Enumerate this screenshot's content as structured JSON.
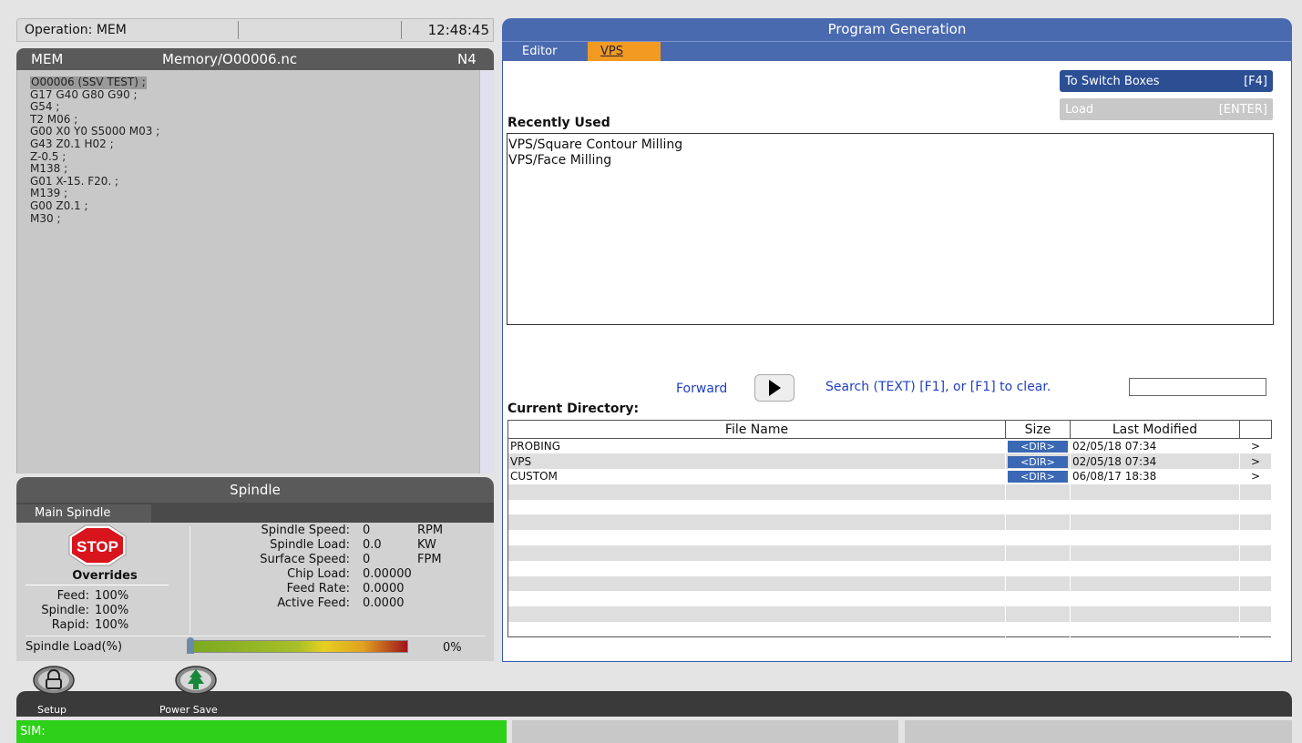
{
  "status_bar": {
    "operation": "Operation: MEM",
    "time": "12:48:45"
  },
  "program": {
    "mode": "MEM",
    "path": "Memory/O00006.nc",
    "line": "N4",
    "code": [
      "O00006 (SSV TEST) ;",
      "G17 G40 G80 G90 ;",
      "G54 ;",
      "T2 M06 ;",
      "G00 X0 Y0 S5000 M03 ;",
      "G43 Z0.1 H02 ;",
      "Z-0.5 ;",
      "M138 ;",
      "G01 X-15. F20. ;",
      "M139 ;",
      "G00 Z0.1 ;",
      "M30 ;"
    ]
  },
  "spindle": {
    "title": "Spindle",
    "tab": "Main Spindle",
    "stop_label": "STOP",
    "overrides_title": "Overrides",
    "overrides": [
      {
        "label": "Feed:",
        "value": "100%"
      },
      {
        "label": "Spindle:",
        "value": "100%"
      },
      {
        "label": "Rapid:",
        "value": "100%"
      }
    ],
    "stats": [
      {
        "label": "Spindle Speed:",
        "value": "0",
        "unit": "RPM"
      },
      {
        "label": "Spindle Load:",
        "value": "0.0",
        "unit": "KW"
      },
      {
        "label": "Surface Speed:",
        "value": "0",
        "unit": "FPM"
      },
      {
        "label": "Chip Load:",
        "value": "0.00000",
        "unit": ""
      },
      {
        "label": "Feed Rate:",
        "value": "0.0000",
        "unit": ""
      },
      {
        "label": "Active Feed:",
        "value": "0.0000",
        "unit": ""
      }
    ],
    "load_label": "Spindle Load(%)",
    "load_value": "0%"
  },
  "program_generation": {
    "title": "Program Generation",
    "tabs": {
      "editor": "Editor",
      "vps": "VPS"
    },
    "switch_button": {
      "label": "To Switch Boxes",
      "key": "[F4]"
    },
    "load_button": {
      "label": "Load",
      "key": "[ENTER]"
    },
    "recently_used_title": "Recently Used",
    "recently_used": [
      "VPS/Square Contour Milling",
      "VPS/Face Milling"
    ],
    "forward_label": "Forward",
    "search_label": "Search (TEXT) [F1], or [F1] to clear.",
    "search_value": "",
    "current_dir_title": "Current Directory:",
    "columns": {
      "name": "File Name",
      "size": "Size",
      "modified": "Last Modified"
    },
    "files": [
      {
        "name": "PROBING",
        "size": "<DIR>",
        "modified": "02/05/18 07:34",
        "arrow": ">"
      },
      {
        "name": "VPS",
        "size": "<DIR>",
        "modified": "02/05/18 07:34",
        "arrow": ">"
      },
      {
        "name": "CUSTOM",
        "size": "<DIR>",
        "modified": "06/08/17 18:38",
        "arrow": ">"
      }
    ]
  },
  "bottom": {
    "setup_label": "Setup",
    "power_save_label": "Power Save",
    "sim_status": "SIM:"
  },
  "colors": {
    "accent_blue": "#4a6ab0",
    "tab_active": "#f39a22",
    "sim_green": "#2ed01a"
  }
}
